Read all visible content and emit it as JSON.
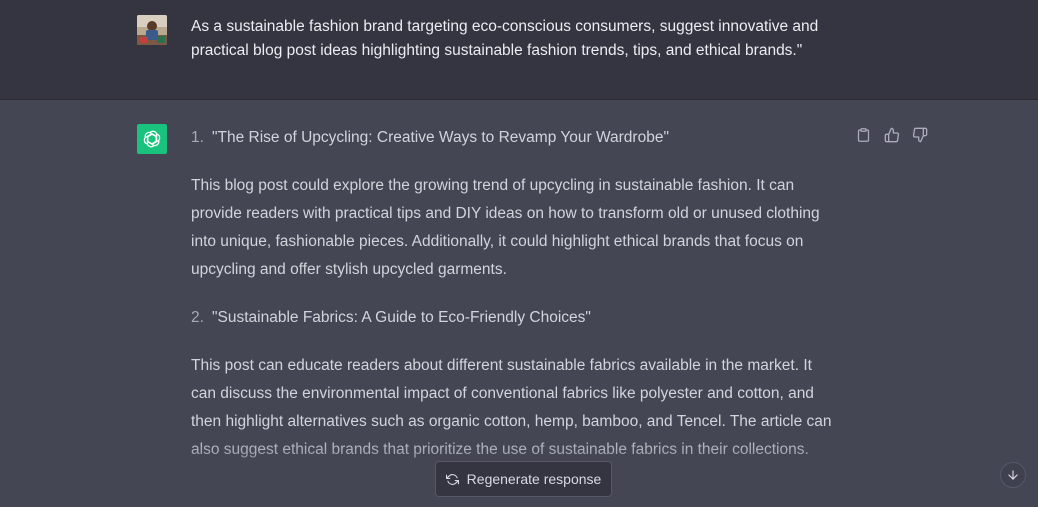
{
  "user_message": {
    "text": "As a sustainable fashion brand targeting eco-conscious consumers, suggest innovative and practical blog post ideas highlighting sustainable fashion trends, tips, and ethical brands.\""
  },
  "assistant_message": {
    "items": [
      {
        "number": "1.",
        "title": "\"The Rise of Upcycling: Creative Ways to Revamp Your Wardrobe\"",
        "description": "This blog post could explore the growing trend of upcycling in sustainable fashion. It can provide readers with practical tips and DIY ideas on how to transform old or unused clothing into unique, fashionable pieces. Additionally, it could highlight ethical brands that focus on upcycling and offer stylish upcycled garments."
      },
      {
        "number": "2.",
        "title": "\"Sustainable Fabrics: A Guide to Eco-Friendly Choices\"",
        "description": "This post can educate readers about different sustainable fabrics available in the market. It can discuss the environmental impact of conventional fabrics like polyester and cotton, and then highlight alternatives such as organic cotton, hemp, bamboo, and Tencel. The article can also suggest ethical brands that prioritize the use of sustainable fabrics in their collections."
      }
    ]
  },
  "actions": {
    "copy_icon": "clipboard-icon",
    "like_icon": "thumbs-up-icon",
    "dislike_icon": "thumbs-down-icon"
  },
  "regenerate": {
    "label": "Regenerate response",
    "icon": "refresh-icon"
  },
  "scroll": {
    "icon": "arrow-down-icon"
  },
  "colors": {
    "user_bg": "#343541",
    "assistant_bg": "#444654",
    "brand_green": "#19c37d",
    "text": "#d1d5db"
  }
}
